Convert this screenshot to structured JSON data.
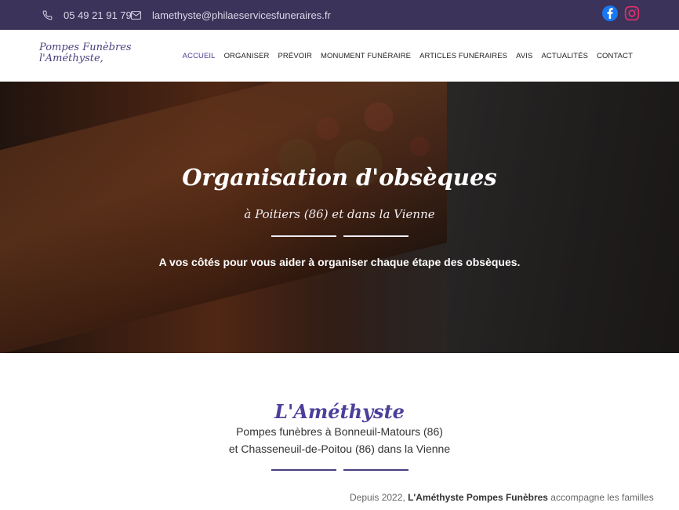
{
  "topbar": {
    "phone": "05 49 21 91 79",
    "email": "lamethyste@philaeservicesfuneraires.fr",
    "icons": [
      "phone-icon",
      "envelope-icon",
      "facebook-icon",
      "instagram-icon"
    ]
  },
  "logo": {
    "line1": "Pompes Funèbres",
    "line2": "l'Améthyste,"
  },
  "nav": {
    "items": [
      {
        "label": "ACCUEIL",
        "active": true
      },
      {
        "label": "ORGANISER"
      },
      {
        "label": "PRÉVOIR"
      },
      {
        "label": "MONUMENT FUNÉRAIRE"
      },
      {
        "label": "ARTICLES FUNÉRAIRES"
      },
      {
        "label": "AVIS"
      },
      {
        "label": "ACTUALITÉS"
      },
      {
        "label": "CONTACT"
      }
    ]
  },
  "hero": {
    "title": "Organisation d'obsèques",
    "subtitle": "à Poitiers (86) et dans la Vienne",
    "tagline": "A vos côtés pour vous aider à organiser chaque étape des obsèques."
  },
  "about": {
    "title": "L'Améthyste",
    "line1": "Pompes funèbres à Bonneuil-Matours (86)",
    "line2": "et Chasseneuil-de-Poitou (86) dans la Vienne",
    "intro_prefix": "Depuis 2022, ",
    "intro_bold": "L'Améthyste Pompes Funèbres",
    "intro_suffix": " accompagne les familles"
  },
  "colors": {
    "topbar": "#3b3359",
    "accent": "#4b3f9a",
    "facebook": "#1877f2"
  }
}
